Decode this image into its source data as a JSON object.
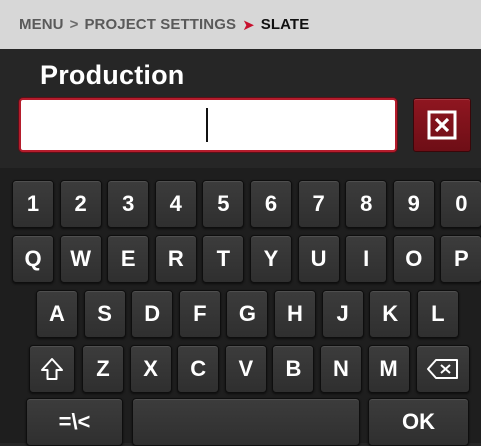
{
  "breadcrumb": {
    "item1": "MENU",
    "item2": "PROJECT SETTINGS",
    "current": "SLATE",
    "separator": ">",
    "active_separator": "➤"
  },
  "field": {
    "title": "Production",
    "value": ""
  },
  "colors": {
    "accent_red": "#c8102e",
    "background": "#262626"
  },
  "keyboard": {
    "row1": [
      "1",
      "2",
      "3",
      "4",
      "5",
      "6",
      "7",
      "8",
      "9",
      "0"
    ],
    "row2": [
      "Q",
      "W",
      "E",
      "R",
      "T",
      "Y",
      "U",
      "I",
      "O",
      "P"
    ],
    "row3": [
      "A",
      "S",
      "D",
      "F",
      "G",
      "H",
      "J",
      "K",
      "L"
    ],
    "row4": [
      "Z",
      "X",
      "C",
      "V",
      "B",
      "N",
      "M"
    ],
    "symbols_label": "=\\<",
    "space_label": "",
    "ok_label": "OK",
    "shift_icon": "shift-icon",
    "backspace_icon": "backspace-icon"
  }
}
